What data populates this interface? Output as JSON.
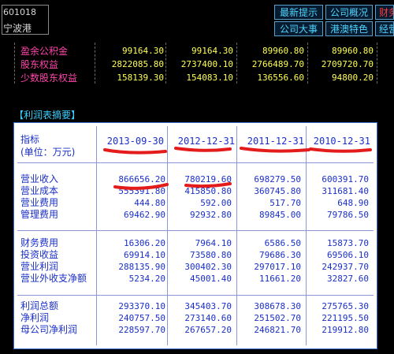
{
  "header": {
    "code": "601018",
    "name": "宁波港",
    "buttons_row1": [
      "最新提示",
      "公司概况",
      "财务"
    ],
    "buttons_row2": [
      "公司大事",
      "港澳特色",
      "经营"
    ]
  },
  "mid": {
    "rows": [
      {
        "label": "盈余公积金",
        "values": [
          "99164.30",
          "99164.30",
          "89960.80",
          "89960.80"
        ]
      },
      {
        "label": "股东权益",
        "values": [
          "2822085.80",
          "2737400.10",
          "2766489.70",
          "2709720.70"
        ]
      },
      {
        "label": "少数股东权益",
        "values": [
          "158139.30",
          "154083.10",
          "136556.60",
          "94800.20"
        ]
      }
    ]
  },
  "table": {
    "title": "【利润表摘要】",
    "header_label_1": "指标",
    "header_label_2": "(单位：万元)",
    "dates": [
      "2013-09-30",
      "2012-12-31",
      "2011-12-31",
      "2010-12-31"
    ],
    "groups": [
      [
        {
          "label": "营业收入",
          "values": [
            "866656.20",
            "780219.60",
            "698279.50",
            "600391.70"
          ]
        },
        {
          "label": "营业成本",
          "values": [
            "555391.80",
            "415850.80",
            "360745.80",
            "311681.40"
          ]
        },
        {
          "label": "营业费用",
          "values": [
            "444.80",
            "592.00",
            "517.70",
            "648.90"
          ]
        },
        {
          "label": "管理费用",
          "values": [
            "69462.90",
            "92932.80",
            "89845.00",
            "79786.50"
          ]
        }
      ],
      [
        {
          "label": "财务费用",
          "values": [
            "16306.20",
            "7964.10",
            "6586.50",
            "15873.70"
          ]
        },
        {
          "label": "投资收益",
          "values": [
            "69914.10",
            "73580.80",
            "79686.30",
            "69506.10"
          ]
        },
        {
          "label": "营业利润",
          "values": [
            "288135.90",
            "300402.30",
            "297017.10",
            "242937.70"
          ]
        },
        {
          "label": "营业外收支净额",
          "values": [
            "5234.20",
            "45001.40",
            "11661.20",
            "32827.60"
          ]
        }
      ],
      [
        {
          "label": "利润总额",
          "values": [
            "293370.10",
            "345403.70",
            "308678.30",
            "275765.30"
          ]
        },
        {
          "label": "净利润",
          "values": [
            "240757.50",
            "273140.60",
            "251502.70",
            "221195.50"
          ]
        },
        {
          "label": "母公司净利润",
          "values": [
            "228597.70",
            "267657.20",
            "246821.70",
            "219912.80"
          ]
        }
      ]
    ]
  },
  "colors": {
    "background": "#000000",
    "table_text": "#1a2fc8",
    "highlight_mark": "#e41b1b",
    "mid_label": "#ff44aa",
    "mid_value": "#ffff55",
    "header_button_text": "#4fd6ff"
  }
}
